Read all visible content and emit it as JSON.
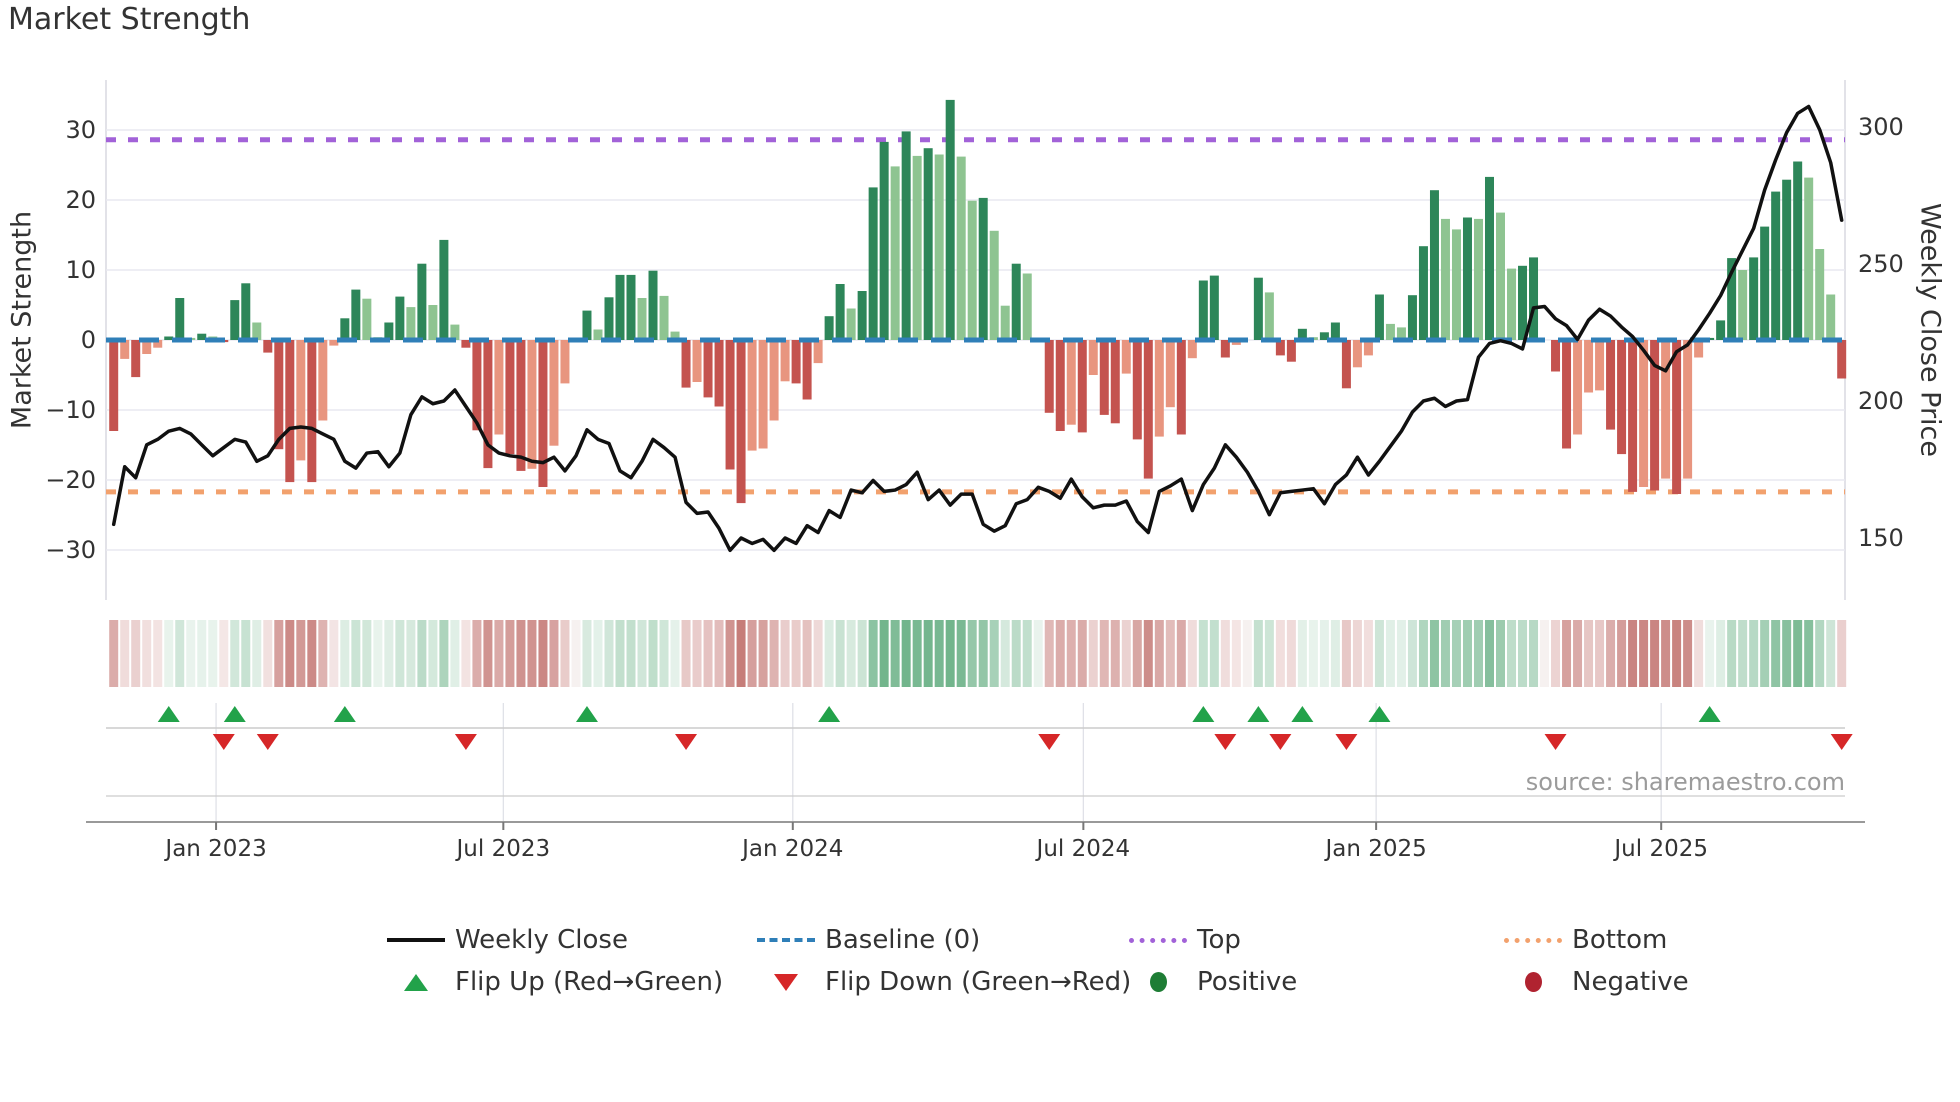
{
  "title": "Market Strength",
  "source": "source: sharemaestro.com",
  "axes": {
    "y_left": {
      "label": "Market Strength",
      "ticks": [
        30,
        20,
        10,
        0,
        -10,
        -20,
        -30
      ]
    },
    "y_right": {
      "label": "Weekly Close Price",
      "ticks": [
        300,
        250,
        200,
        150
      ]
    },
    "x_tick_labels": [
      "Jan 2023",
      "Jul 2023",
      "Jan 2024",
      "Jul 2024",
      "Jan 2025",
      "Jul 2025"
    ],
    "x_tick_positions": [
      9.3,
      35.4,
      61.7,
      88.1,
      114.7,
      140.6
    ]
  },
  "legend": {
    "weekly_close": "Weekly Close",
    "baseline": "Baseline (0)",
    "top": "Top",
    "bottom": "Bottom",
    "flip_up": "Flip Up (Red→Green)",
    "flip_down": "Flip Down (Green→Red)",
    "positive": "Positive",
    "negative": "Negative"
  },
  "colors": {
    "bar_pos_dark": "#2d8659",
    "bar_pos_light": "#8ec491",
    "bar_neg_dark": "#c4534f",
    "bar_neg_light": "#e8957f",
    "line": "#111111",
    "baseline_line": "#2f7fb8",
    "top_line": "#a262d8",
    "bottom_line": "#f2a16d",
    "flip_up": "#22a24a",
    "flip_down": "#d62728",
    "positive_dot": "#1e7d35",
    "negative_dot": "#b02330",
    "grid": "#e9e9f0",
    "spine": "#d8d8e0",
    "axis_line": "#999999",
    "tick_mark": "#777777",
    "panel_line": "#cccccc",
    "vgrid": "#e0e1e8",
    "heat_pos_base": [
      74,
      160,
      108
    ],
    "heat_neg_base": [
      170,
      60,
      55
    ]
  },
  "chart_data": {
    "type": "bar+line",
    "title": "Market Strength",
    "ylabel_left": "Market Strength",
    "ylabel_right": "Weekly Close Price",
    "ylim_left": [
      -35,
      40
    ],
    "ylim_right_labels": [
      150,
      300
    ],
    "baseline_value": 0,
    "top_value": 28.6,
    "bottom_value": -21.7,
    "legend_position": "bottom",
    "grid": "horizontal",
    "series": [
      {
        "name": "Market Strength (weekly bars)",
        "values": [
          -13.0,
          -2.7,
          -5.3,
          -2.0,
          -1.1,
          0.5,
          6.0,
          0.3,
          0.9,
          0.5,
          -0.3,
          5.7,
          8.1,
          2.5,
          -1.8,
          -15.6,
          -20.3,
          -17.2,
          -20.3,
          -11.5,
          -0.8,
          3.1,
          7.2,
          5.9,
          0.4,
          2.5,
          6.2,
          4.7,
          10.9,
          5.0,
          14.3,
          2.2,
          -1.1,
          -12.9,
          -18.3,
          -13.5,
          -16.3,
          -18.7,
          -18.4,
          -21.0,
          -15.1,
          -6.2,
          0,
          4.2,
          1.5,
          6.1,
          9.3,
          9.3,
          6.0,
          9.9,
          6.3,
          1.2,
          -6.8,
          -6.0,
          -8.2,
          -9.5,
          -18.5,
          -23.3,
          -15.8,
          -15.5,
          -11.5,
          -5.9,
          -6.2,
          -8.5,
          -3.3,
          3.4,
          8.0,
          4.5,
          7.0,
          21.8,
          28.3,
          24.8,
          29.8,
          26.3,
          27.4,
          26.5,
          34.3,
          26.2,
          19.9,
          20.3,
          15.6,
          4.9,
          10.9,
          9.5,
          0.2,
          -10.4,
          -13.0,
          -12.1,
          -13.2,
          -5.0,
          -10.7,
          -11.9,
          -4.8,
          -14.2,
          -19.8,
          -13.8,
          -9.6,
          -13.5,
          -2.6,
          8.5,
          9.2,
          -2.5,
          -0.7,
          0,
          8.9,
          6.8,
          -2.2,
          -3.1,
          1.6,
          0.4,
          1.1,
          2.5,
          -6.9,
          -3.9,
          -2.2,
          6.5,
          2.3,
          1.8,
          6.4,
          13.4,
          21.4,
          17.3,
          15.8,
          17.5,
          17.3,
          23.3,
          18.2,
          10.2,
          10.6,
          11.8,
          0,
          -4.5,
          -15.5,
          -13.5,
          -7.5,
          -7.2,
          -12.8,
          -16.3,
          -21.7,
          -21.0,
          -21.5,
          -19.8,
          -22.0,
          -19.8,
          -2.5,
          0.3,
          2.8,
          11.7,
          10.0,
          11.8,
          16.2,
          21.2,
          22.9,
          25.5,
          23.2,
          13.0,
          6.5,
          -5.5
        ]
      },
      {
        "name": "Weekly Close",
        "values": [
          155,
          176,
          172,
          184,
          186,
          189,
          190,
          188,
          184,
          180,
          183,
          186,
          185,
          178,
          180,
          186,
          190,
          190.5,
          190,
          188,
          186,
          178,
          175.5,
          181,
          181.5,
          176,
          181,
          195,
          201.5,
          199,
          200,
          204,
          198,
          192,
          184,
          181,
          180,
          179.5,
          178,
          177.5,
          179.5,
          174.5,
          180,
          189.5,
          186,
          184.5,
          174.5,
          172,
          178,
          186,
          183,
          179.5,
          163,
          159,
          159.5,
          153.5,
          145.5,
          150,
          148,
          149.5,
          145.5,
          150,
          148,
          154.5,
          152,
          160,
          157.5,
          167.5,
          166.5,
          171,
          167,
          167.5,
          169.5,
          174,
          164,
          167.5,
          162,
          166,
          166,
          155,
          152.5,
          154.5,
          162.5,
          164,
          168.5,
          167,
          164.5,
          171.5,
          165,
          161,
          162,
          162,
          163.5,
          156,
          152,
          167,
          169,
          171.5,
          160,
          169.5,
          175.5,
          184,
          179.5,
          174,
          167,
          158.5,
          166.5,
          167,
          167.5,
          168,
          162.5,
          169.5,
          173,
          179.5,
          173,
          178,
          183.5,
          189,
          196,
          200,
          201,
          198,
          200,
          200.5,
          216,
          221,
          222,
          221,
          219,
          234,
          234.5,
          230,
          227.5,
          222.5,
          229.5,
          233.5,
          231,
          227,
          223.5,
          218.5,
          213,
          211,
          218,
          220.5,
          226,
          232,
          238.5,
          247,
          255,
          263,
          277,
          288,
          298,
          305,
          307.5,
          299,
          287,
          266
        ]
      }
    ],
    "flip_up_indices": [
      5,
      11,
      21,
      43,
      65,
      99,
      104,
      108,
      115,
      145
    ],
    "flip_down_indices": [
      10,
      14,
      32,
      52,
      85,
      101,
      106,
      112,
      131,
      157
    ]
  }
}
